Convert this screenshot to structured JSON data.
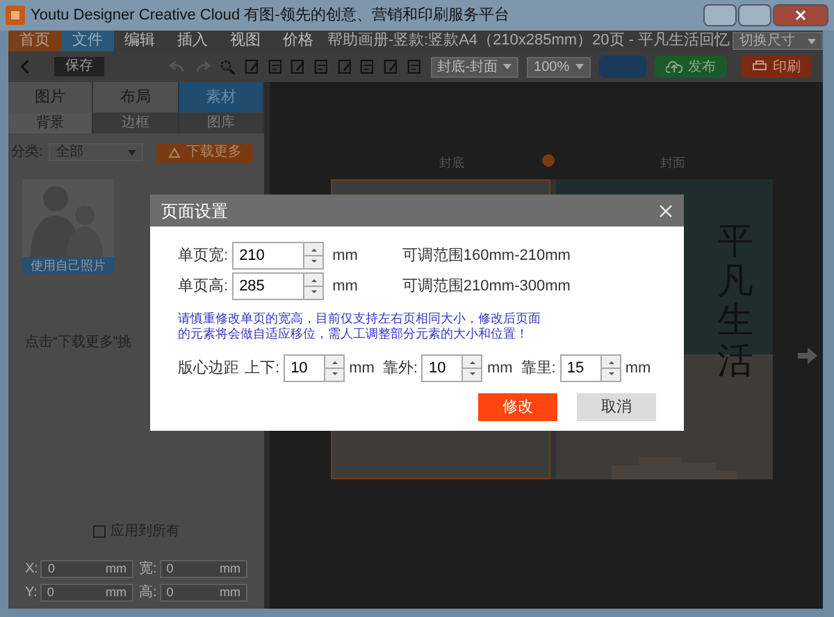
{
  "window": {
    "title": "Youtu Designer Creative Cloud 有图-领先的创意、营销和印刷服务平台"
  },
  "menu": [
    {
      "label": "首页",
      "kind": "home"
    },
    {
      "label": "文件",
      "kind": "file"
    },
    {
      "label": "编辑",
      "kind": "plain"
    },
    {
      "label": "插入",
      "kind": "plain"
    },
    {
      "label": "视图",
      "kind": "plain"
    },
    {
      "label": "价格",
      "kind": "plain"
    }
  ],
  "document_title": "帮助画册-竖款:竖款A4（210x285mm）20页 - 平凡生活回忆",
  "size_select": {
    "value": "切换尺寸"
  },
  "toolbar": {
    "save": "保存",
    "page_select": "封底-封面",
    "zoom_select": "100%",
    "publish": "发布",
    "print": "印刷"
  },
  "left_panel": {
    "tabs": [
      {
        "label": "图片",
        "selected": false
      },
      {
        "label": "布局",
        "selected": false
      },
      {
        "label": "素材",
        "selected": true
      }
    ],
    "subtabs": [
      {
        "label": "背景",
        "selected": true
      },
      {
        "label": "边框",
        "selected": false
      },
      {
        "label": "图库",
        "selected": false
      }
    ],
    "category_label": "分类:",
    "category_value": "全部",
    "download_button": "下载更多",
    "thumbnail_caption": "使用自己照片",
    "hint": "点击“下载更多”挑",
    "apply_all": {
      "label": "应用到所有",
      "checked": false
    },
    "position_fields": [
      {
        "label": "X:",
        "value": "0",
        "unit": "mm"
      },
      {
        "label": "宽:",
        "value": "0",
        "unit": "mm"
      },
      {
        "label": "Y:",
        "value": "0",
        "unit": "mm"
      },
      {
        "label": "高:",
        "value": "0",
        "unit": "mm"
      }
    ]
  },
  "canvas": {
    "page_labels": [
      "封底",
      "封面"
    ],
    "cover_title": "平凡生活"
  },
  "dialog": {
    "title": "页面设置",
    "size_rows": [
      {
        "label": "单页宽:",
        "value": "210",
        "unit": "mm",
        "range": "可调范围160mm-210mm"
      },
      {
        "label": "单页高:",
        "value": "285",
        "unit": "mm",
        "range": "可调范围210mm-300mm"
      }
    ],
    "warning": [
      "请慎重修改单页的宽高，目前仅支持左右页相同大小，修改后页面",
      "的元素将会做自适应移位，需人工调整部分元素的大小和位置！"
    ],
    "margin_label": "版心边距",
    "margin_fields": [
      {
        "label": "上下:",
        "value": "10",
        "unit": "mm"
      },
      {
        "label": "靠外:",
        "value": "10",
        "unit": "mm"
      },
      {
        "label": "靠里:",
        "value": "15",
        "unit": "mm"
      }
    ],
    "confirm": "修改",
    "cancel": "取消"
  }
}
